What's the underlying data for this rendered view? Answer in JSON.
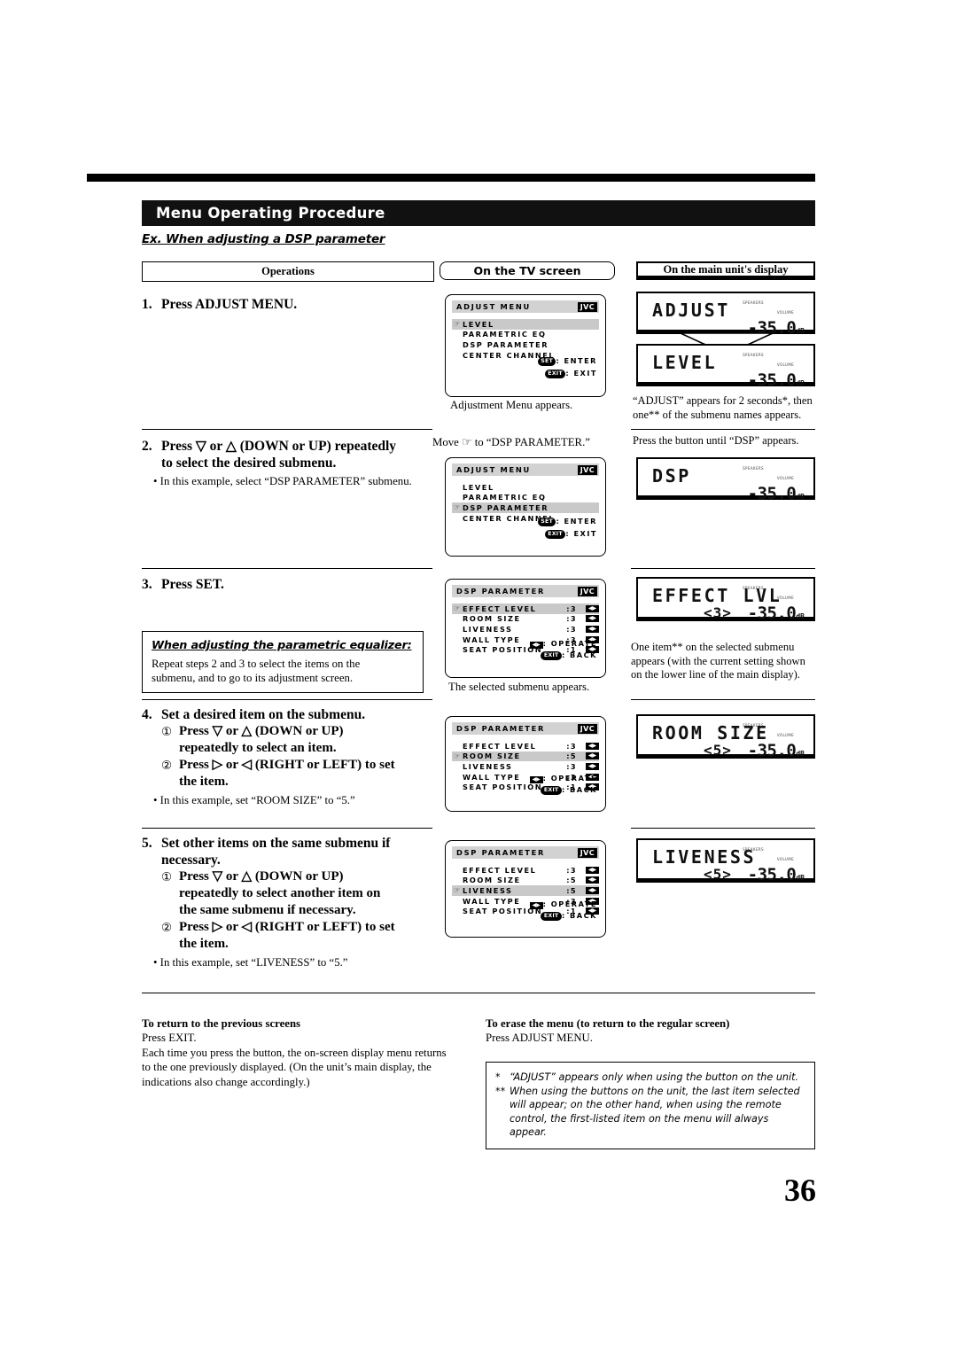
{
  "page": {
    "number": "36",
    "section_title": "Menu Operating Procedure",
    "example_line": "Ex. When adjusting a DSP parameter"
  },
  "columns": {
    "operations": "Operations",
    "tv_screen": "On the TV screen",
    "unit_display": "On the main unit's display"
  },
  "steps": [
    {
      "num": "1.",
      "head": "Press ADJUST MENU."
    },
    {
      "num": "2.",
      "head_line1": "Press ▽ or △ (DOWN or UP) repeatedly",
      "head_line2": "to select the desired submenu.",
      "note": "• In this example, select “DSP PARAMETER” submenu."
    },
    {
      "num": "3.",
      "head": "Press SET."
    },
    {
      "num": "4.",
      "head": "Set a desired item on the submenu.",
      "sub1_num": "①",
      "sub1_line1": "Press ▽ or △ (DOWN or UP)",
      "sub1_line2": "repeatedly to select an item.",
      "sub2_num": "②",
      "sub2_line1": "Press ▷ or ◁ (RIGHT or LEFT) to set",
      "sub2_line2": "the item.",
      "note": "• In this example, set “ROOM SIZE” to “5.”"
    },
    {
      "num": "5.",
      "head_line1": "Set other items on the same submenu if",
      "head_line2": "necessary.",
      "sub1_num": "①",
      "sub1_line1": "Press ▽ or △ (DOWN or UP)",
      "sub1_line2": "repeatedly to select another item on",
      "sub1_line3": "the same submenu if necessary.",
      "sub2_num": "②",
      "sub2_line1": "Press ▷ or ◁ (RIGHT or LEFT) to set",
      "sub2_line2": "the item.",
      "note": "• In this example, set “LIVENESS” to “5.”"
    }
  ],
  "callout": {
    "title": "When adjusting the parametric equalizer:",
    "line1": "Repeat steps 2 and 3 to select the items on the",
    "line2": "submenu, and to go to its adjustment screen."
  },
  "tv_screens": [
    {
      "id": "adjust-menu-level",
      "title": "ADJUST MENU",
      "logo": "JVC",
      "rows": [
        {
          "cursor": "☞",
          "label": "LEVEL",
          "selected": true
        },
        {
          "cursor": "",
          "label": "PARAMETRIC EQ",
          "selected": false
        },
        {
          "cursor": "",
          "label": "DSP PARAMETER",
          "selected": false
        },
        {
          "cursor": "",
          "label": "CENTER CHANNEL",
          "selected": false
        }
      ],
      "foot1_key": "SET",
      "foot1_text": ": ENTER",
      "foot2_key": "EXIT",
      "foot2_text": ": EXIT",
      "caption": "Adjustment Menu appears."
    },
    {
      "id": "adjust-menu-dsp",
      "title": "ADJUST MENU",
      "logo": "JVC",
      "rows": [
        {
          "cursor": "",
          "label": "LEVEL",
          "selected": false
        },
        {
          "cursor": "",
          "label": "PARAMETRIC EQ",
          "selected": false
        },
        {
          "cursor": "☞",
          "label": "DSP PARAMETER",
          "selected": true
        },
        {
          "cursor": "",
          "label": "CENTER CHANNEL",
          "selected": false
        }
      ],
      "foot1_key": "SET",
      "foot1_text": ": ENTER",
      "foot2_key": "EXIT",
      "foot2_text": ": EXIT",
      "move_text": "Move ☞ to “DSP PARAMETER.”"
    },
    {
      "id": "dsp-parameter-effect",
      "title": "DSP PARAMETER",
      "logo": "JVC",
      "rows": [
        {
          "cursor": "☞",
          "label": "EFFECT LEVEL",
          "value": ":3",
          "selected": true,
          "pad": true
        },
        {
          "cursor": "",
          "label": "ROOM SIZE",
          "value": ":3",
          "selected": false,
          "pad": true
        },
        {
          "cursor": "",
          "label": "LIVENESS",
          "value": ":3",
          "selected": false,
          "pad": true
        },
        {
          "cursor": "",
          "label": "WALL TYPE",
          "value": ":3",
          "selected": false,
          "pad": true
        },
        {
          "cursor": "",
          "label": "SEAT POSITION",
          "value": ":1",
          "selected": false,
          "pad": true
        }
      ],
      "foot1_pad": "◀▶",
      "foot1_text": ": OPERATE",
      "foot2_key": "EXIT",
      "foot2_text": ": BACK",
      "caption": "The selected submenu appears."
    },
    {
      "id": "dsp-parameter-roomsize",
      "title": "DSP PARAMETER",
      "logo": "JVC",
      "rows": [
        {
          "cursor": "",
          "label": "EFFECT LEVEL",
          "value": ":3",
          "selected": false,
          "pad": true
        },
        {
          "cursor": "☞",
          "label": "ROOM SIZE",
          "value": ":5",
          "selected": true,
          "pad": true
        },
        {
          "cursor": "",
          "label": "LIVENESS",
          "value": ":3",
          "selected": false,
          "pad": true
        },
        {
          "cursor": "",
          "label": "WALL TYPE",
          "value": ":3",
          "selected": false,
          "pad": true
        },
        {
          "cursor": "",
          "label": "SEAT POSITION",
          "value": ":1",
          "selected": false,
          "pad": true
        }
      ],
      "foot1_pad": "◀▶",
      "foot1_text": ": OPERATE",
      "foot2_key": "EXIT",
      "foot2_text": ": BACK"
    },
    {
      "id": "dsp-parameter-liveness",
      "title": "DSP PARAMETER",
      "logo": "JVC",
      "rows": [
        {
          "cursor": "",
          "label": "EFFECT LEVEL",
          "value": ":3",
          "selected": false,
          "pad": true
        },
        {
          "cursor": "",
          "label": "ROOM SIZE",
          "value": ":5",
          "selected": false,
          "pad": true
        },
        {
          "cursor": "☞",
          "label": "LIVENESS",
          "value": ":5",
          "selected": true,
          "pad": true
        },
        {
          "cursor": "",
          "label": "WALL TYPE",
          "value": ":3",
          "selected": false,
          "pad": true
        },
        {
          "cursor": "",
          "label": "SEAT POSITION",
          "value": ":1",
          "selected": false,
          "pad": true
        }
      ],
      "foot1_pad": "◀▶",
      "foot1_text": ": OPERATE",
      "foot2_key": "EXIT",
      "foot2_text": ": BACK"
    }
  ],
  "unit_displays": [
    {
      "id": "unit-adjust",
      "main": "ADJUST",
      "setting": "",
      "volume": "-35.0",
      "db": "dB",
      "spk": "SPEAKERS",
      "vol_label": "VOLUME"
    },
    {
      "id": "unit-level",
      "main": "LEVEL",
      "setting": "",
      "volume": "-35.0",
      "db": "dB",
      "spk": "SPEAKERS",
      "vol_label": "VOLUME"
    },
    {
      "id": "unit-dsp",
      "main": "DSP",
      "setting": "",
      "volume": "-35.0",
      "db": "dB",
      "spk": "SPEAKERS",
      "vol_label": "VOLUME"
    },
    {
      "id": "unit-effect",
      "main": "EFFECT LVL",
      "setting": "<3>",
      "volume": "-35.0",
      "db": "dB",
      "spk": "SPEAKERS",
      "vol_label": "VOLUME"
    },
    {
      "id": "unit-roomsize",
      "main": "ROOM SIZE",
      "setting": "<5>",
      "volume": "-35.0",
      "db": "dB",
      "spk": "SPEAKERS",
      "vol_label": "VOLUME"
    },
    {
      "id": "unit-liveness",
      "main": "LIVENESS",
      "setting": "<5>",
      "volume": "-35.0",
      "db": "dB",
      "spk": "SPEAKERS",
      "vol_label": "VOLUME"
    }
  ],
  "unit_captions": {
    "step1_line1": "“ADJUST” appears for 2 seconds*, then",
    "step1_line2": "one** of the submenu names appears.",
    "step2": "Press the button until “DSP” appears.",
    "step3_line1": "One item** on the selected submenu",
    "step3_line2": "appears (with the current setting shown",
    "step3_line3": "on the lower line of the main display)."
  },
  "footer": {
    "left_title": "To return to the previous screens",
    "left_line1": "Press EXIT.",
    "left_line2": "Each time you press the button, the on-screen display menu returns",
    "left_line3": "to the one previously displayed. (On the unit’s main display, the",
    "left_line4": "indications also change accordingly.)",
    "right_title": "To erase the menu (to return to the regular screen)",
    "right_line1": "Press ADJUST MENU.",
    "note1_mark": "*",
    "note1_text": "“ADJUST” appears only when using the button on the unit.",
    "note2_mark": "**",
    "note2_line1": "When using the buttons on the unit, the last item selected will",
    "note2_line2": "appear; on the other hand, when using the remote control, the",
    "note2_line3": "first-listed item on the menu will always appear."
  }
}
